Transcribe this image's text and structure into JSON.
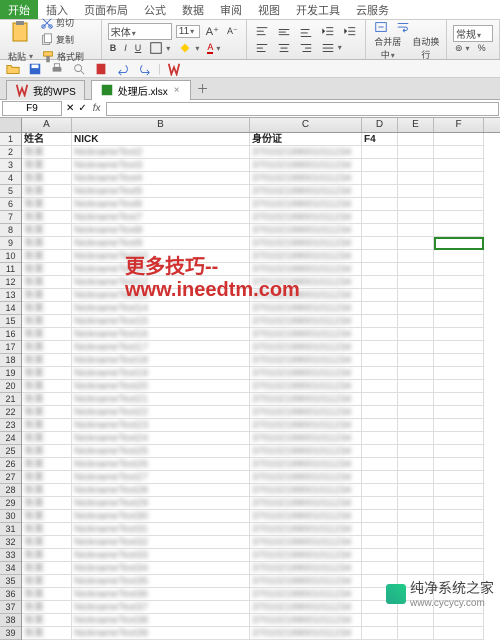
{
  "menu": {
    "items": [
      "开始",
      "插入",
      "页面布局",
      "公式",
      "数据",
      "审阅",
      "视图",
      "开发工具",
      "云服务"
    ],
    "active": 0
  },
  "ribbon": {
    "clipboard": {
      "paste": "粘贴",
      "cut": "剪切",
      "copy": "复制",
      "format_painter": "格式刷"
    },
    "font": {
      "name": "宋体",
      "size": "11",
      "bold": "B",
      "italic": "I",
      "underline": "U"
    },
    "align": {
      "merge": "合并居中",
      "wrap": "自动换行"
    },
    "style": {
      "normal": "常规"
    }
  },
  "tabs": [
    {
      "icon": "wps",
      "label": "我的WPS",
      "closable": false
    },
    {
      "icon": "xls",
      "label": "处理后.xlsx",
      "closable": true,
      "active": true
    }
  ],
  "namebox": "F9",
  "columns": [
    "A",
    "B",
    "C",
    "D",
    "E",
    "F"
  ],
  "col_widths": {
    "A": 50,
    "B": 178,
    "C": 112,
    "D": 36,
    "E": 36,
    "F": 50
  },
  "headers_row": {
    "A": "姓名",
    "B": "NICK",
    "C": "身份证",
    "D": "F4"
  },
  "active_cell": "F9",
  "row_count": 39,
  "watermark1": "更多技巧--www.ineedtm.com",
  "watermark2": {
    "title": "纯净系统之家",
    "sub": "www.cycycy.com"
  }
}
